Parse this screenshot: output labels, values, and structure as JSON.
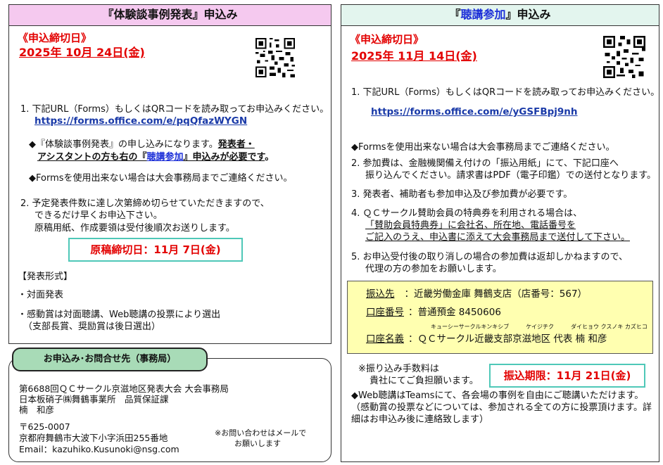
{
  "left": {
    "title_prefix": "『",
    "title_main": "体験談事例発表",
    "title_suffix": "』申込み",
    "deadline_label": "《申込締切日》",
    "deadline_date": "2025年 10月 24日(金)",
    "item1_text": "1.  下記URL（Forms）もしくはQRコードを読み取ってお申込みください。",
    "item1_url": "https://forms.office.com/e/pqQfazWYGN",
    "note1_a": "◆『体験談事例発表』の申し込みになります。",
    "note1_b": "発表者・",
    "note1_c": "アシスタントの方も右の『",
    "note1_d": "聴講参加",
    "note1_e": "』申込みが必要です",
    "note1_f": "。",
    "note2": "◆Formsを使用出来ない場合は大会事務局までご連絡ください。",
    "item2_line1": "2.  予定発表件数に達し次第締め切らせていただきますので、",
    "item2_line2": "できるだけ早くお申込下さい。",
    "item2_line3": "原稿用紙、作成要領は受付後順次お送りします。",
    "manuscript_deadline": "原稿締切日：11月 7日(金)",
    "format_heading": "【発表形式】",
    "format_1": "・対面発表",
    "format_2_line1": "・感動賞は対面聴講、Web聴講の投票により選出",
    "format_2_line2": "（支部長賞、奨励賞は後日選出）"
  },
  "contact": {
    "tab_label": "お申込み･お問合せ先（事務局）",
    "line1": "第6688回ＱＣサークル京滋地区発表大会 大会事務局",
    "line2": "日本板硝子㈱舞鶴事業所　品質保証課",
    "line3": "楠　和彦",
    "line4": "〒625-0007",
    "line5": "京都府舞鶴市大波下小字浜田255番地",
    "line6": "Email：kazuhiko.Kusunoki@nsg.com",
    "mail_note_1": "※お問い合わせはメールで",
    "mail_note_2": "お願いします"
  },
  "right": {
    "title_prefix": "『",
    "title_main": "聴講参加",
    "title_suffix": "』申込み",
    "deadline_label": "《申込締切日》",
    "deadline_date": "2025年 11月 14日(金)",
    "item1_text": "1.  下記URL（Forms）もしくはQRコードを読み取ってお申込みください。",
    "item1_url": "https://forms.office.com/e/yGSFBpj9nh",
    "note1": "◆Formsを使用出来ない場合は大会事務局までご連絡ください。",
    "item2_line1": "2.  参加費は、金融機関備え付けの「振込用紙」にて、下記口座へ",
    "item2_line2": "振り込んでください。請求書はPDF（電子印鑑）での送付となります。",
    "item3": "3.  発表者、補助者も参加申込及び参加費が必要です。",
    "item4_line1": "4.  ＱＣサークル賛助会員の特典券を利用される場合は、",
    "item4_line2": "「賛助会員特典券」に会社名、所在地、電話番号を",
    "item4_line3": "ご記入のうえ、申込書に添えて大会事務局まで送付して下さい。",
    "item5_line1": "5.  お申込受付後の取り消しの場合の参加費は返却しかねますので、",
    "item5_line2": "代理の方の参加をお願いします。",
    "bank": {
      "label1": "振込先",
      "value1": "：近畿労働金庫 舞鶴支店（店番号：567）",
      "label2": "口座番号",
      "value2": "：普通預金 8450606",
      "furigana": "キューシーサークルキンキシブ　　　ケイジチク　　　ダイヒョウ クスノキ カズヒコ",
      "label3": "口座名義",
      "value3": "：ＱＣサークル近畿支部京滋地区 代表 楠 和彦"
    },
    "fee_note_1": "※振り込み手数料は",
    "fee_note_2": "貴社にてご負担願います。",
    "transfer_deadline": "振込期限：11月 21日(金)",
    "web_note_1": "◆Web聴講はTeamsにて、各会場の事例を自由にご聴講いただけます。",
    "web_note_2": "（感動賞の投票などについては、参加される全ての方に投票頂けます。詳",
    "web_note_3": "細はお申込み後に連絡致します）"
  }
}
